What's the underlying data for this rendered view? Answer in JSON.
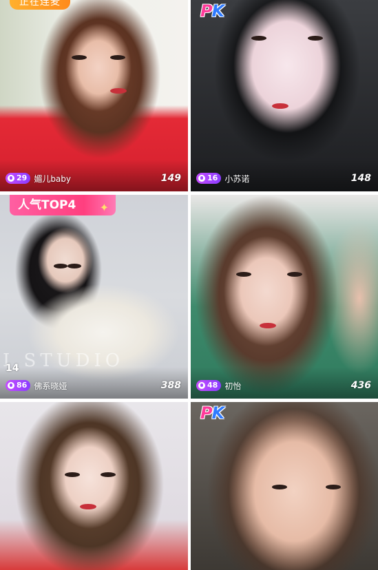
{
  "cards": [
    {
      "status_badge": "正在连麦",
      "level": "29",
      "name": "媚儿baby",
      "viewers": "149"
    },
    {
      "pk_badge": {
        "p": "P",
        "k": "K"
      },
      "level": "16",
      "name": "小苏诺",
      "viewers": "148"
    },
    {
      "rank_badge": "人气TOP4",
      "side_count": "14",
      "level": "86",
      "name": "佛系晓娅",
      "viewers": "388"
    },
    {
      "level": "48",
      "name": "初怡",
      "viewers": "436"
    },
    {},
    {
      "pk_badge": {
        "p": "P",
        "k": "K"
      }
    }
  ],
  "colors": {
    "status_badge": "#ff9f24",
    "pk_p": "#ff3b9a",
    "pk_k": "#2f7bff",
    "rank_badge": "#ff4f8f",
    "level_badge": "#a347ff"
  },
  "icons": {
    "level": "mic-icon",
    "rank": "sparkle-icon"
  }
}
